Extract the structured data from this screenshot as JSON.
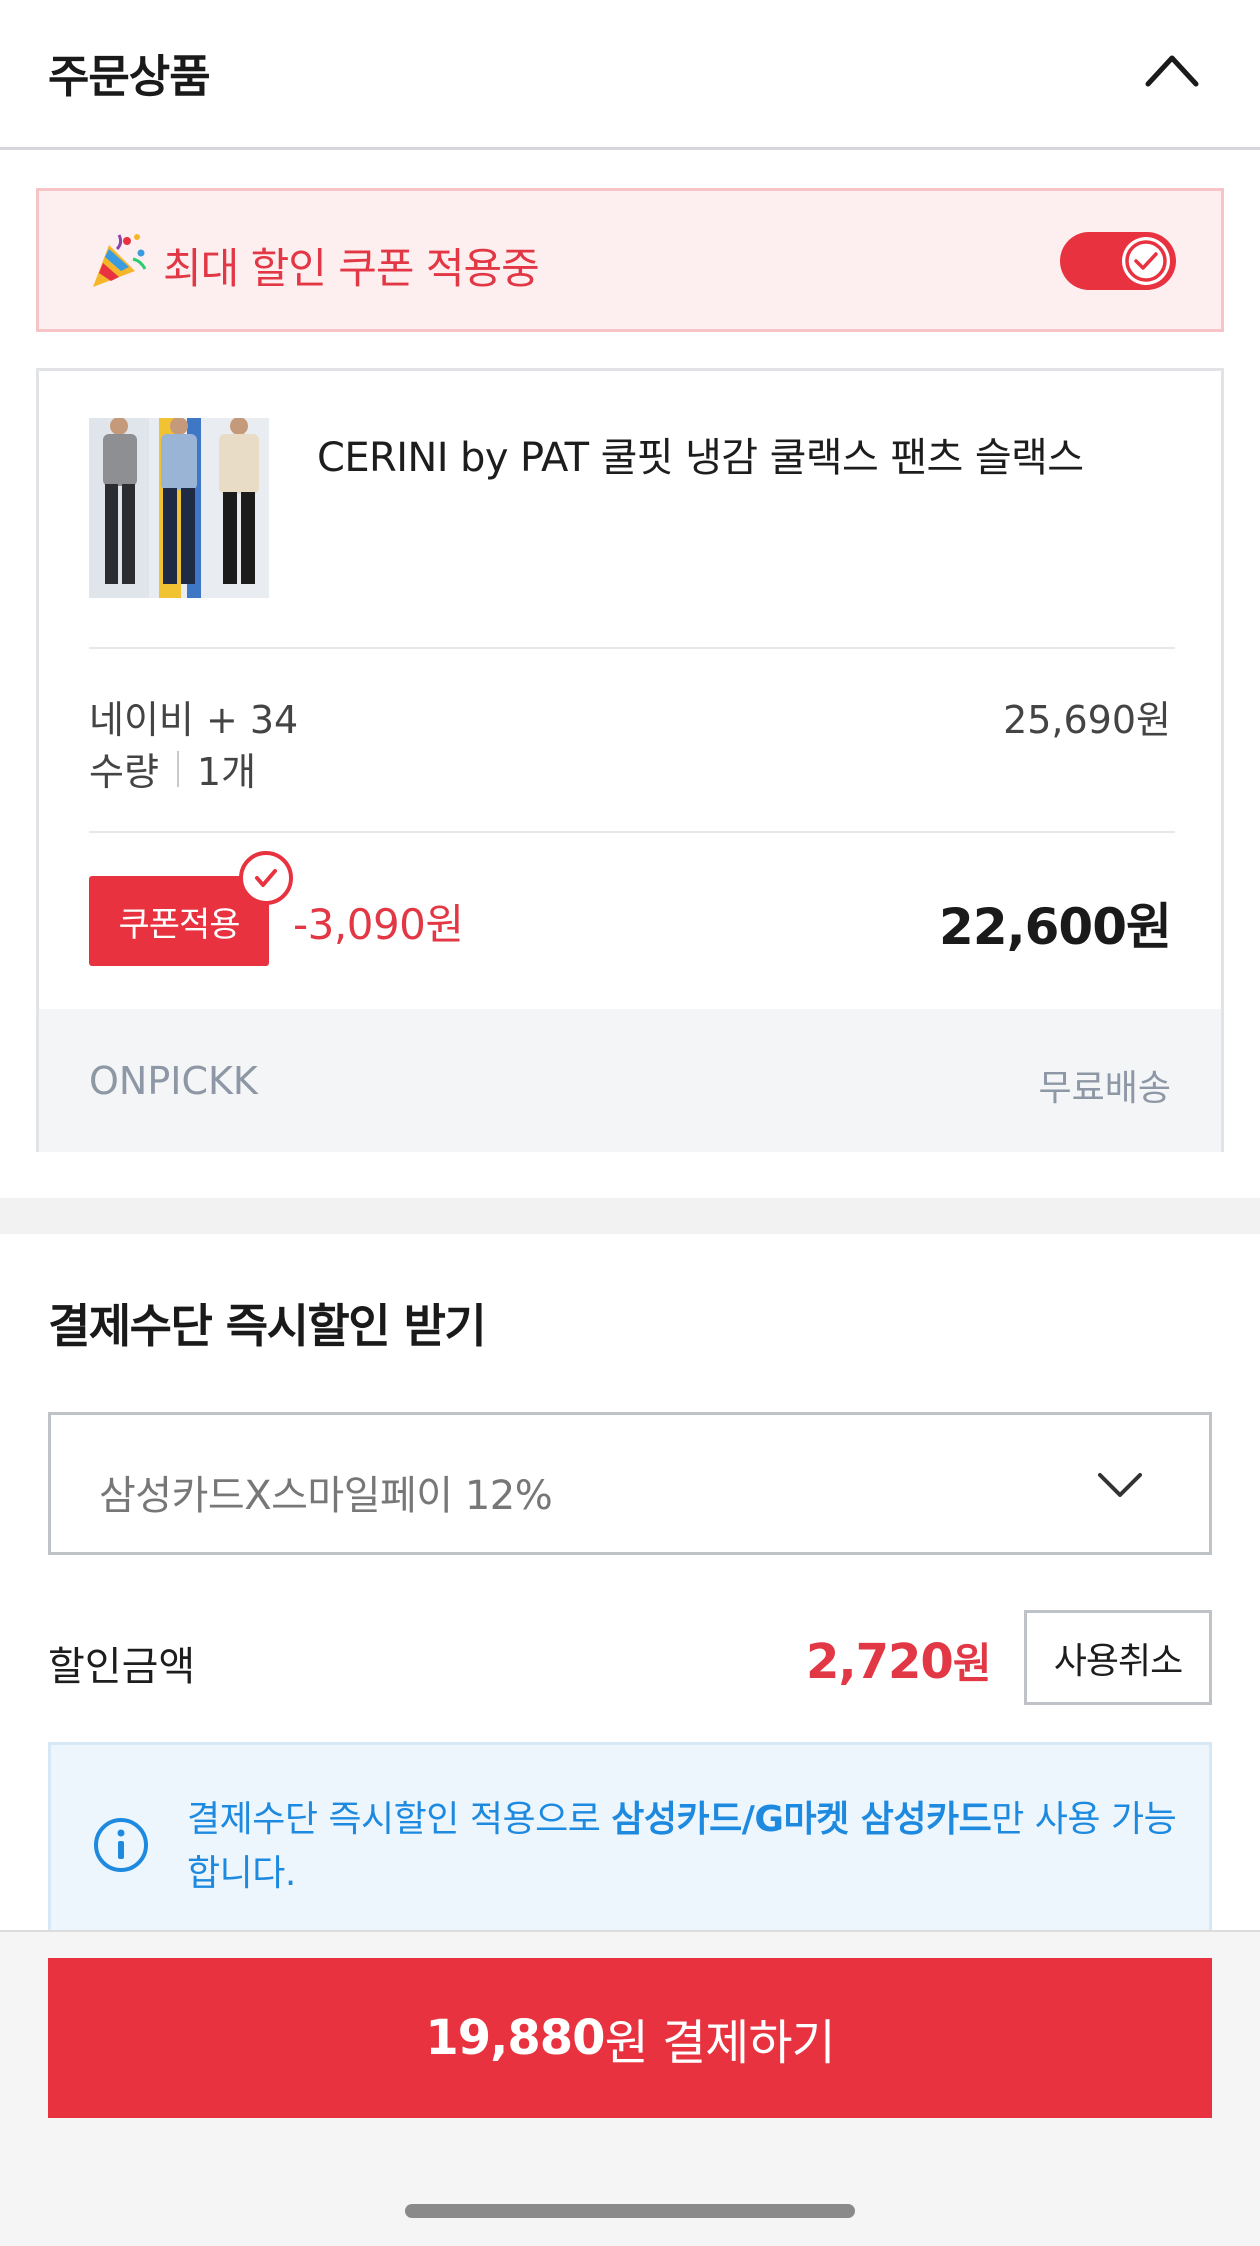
{
  "header": {
    "title": "주문상품"
  },
  "coupon_banner": {
    "text": "최대 할인 쿠폰 적용중",
    "toggle_on": true
  },
  "product": {
    "name": "CERINI by PAT 쿨핏 냉감 쿨랙스 팬츠 슬랙스",
    "option": "네이비 + 34",
    "quantity_label": "수량",
    "quantity_value": "1개",
    "original_price": "25,690원",
    "coupon_button": "쿠폰적용",
    "discount": "-3,090원",
    "final_price": "22,600원",
    "seller": "ONPICKK",
    "shipping": "무료배송"
  },
  "payment": {
    "title": "결제수단 즉시할인 받기",
    "selected_method": "삼성카드X스마일페이 12%",
    "discount_label": "할인금액",
    "discount_amount": "2,720",
    "discount_unit": "원",
    "cancel_label": "사용취소",
    "info_prefix": "결제수단 즉시할인 적용으로 ",
    "info_bold": "삼성카드/G마켓 삼성카드",
    "info_suffix": "만 사용 가능합니다."
  },
  "checkout": {
    "amount": "19,880",
    "label": "원 결제하기"
  },
  "colors": {
    "accent": "#e8323f",
    "info": "#1d8ae0",
    "banner_bg": "#fdeff0"
  }
}
